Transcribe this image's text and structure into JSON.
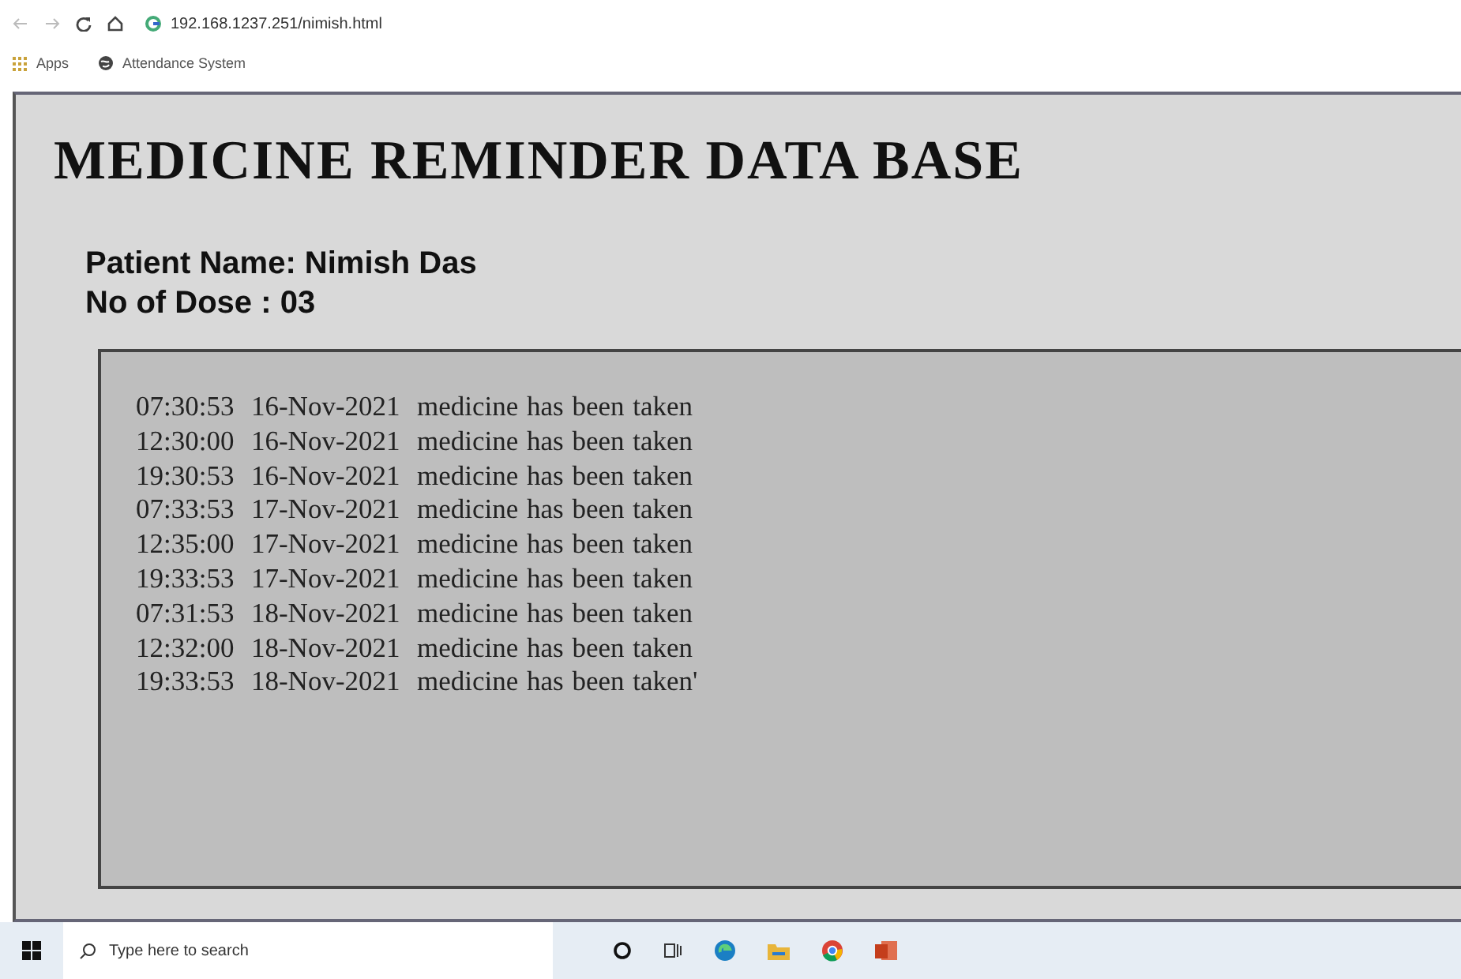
{
  "browser": {
    "address": "192.168.1237.251/nimish.html",
    "bookmarks": [
      "Apps",
      "Attendance System"
    ]
  },
  "page": {
    "title": "MEDICINE REMINDER DATA BASE",
    "patient": "Patient Name: Nimish Das",
    "doses": "No of Dose : 03",
    "log": [
      "07:30:53  16-Nov-2021  medicine has been taken",
      "12:30:00  16-Nov-2021  medicine has been taken",
      "19:30:53  16-Nov-2021  medicine has been taken",
      "07:33:53  17-Nov-2021  medicine has been taken",
      "12:35:00  17-Nov-2021  medicine has been taken",
      "19:33:53  17-Nov-2021  medicine has been taken",
      "07:31:53  18-Nov-2021  medicine has been taken",
      "12:32:00  18-Nov-2021  medicine has been taken",
      "19:33:53  18-Nov-2021  medicine has been taken'"
    ]
  },
  "taskbar": {
    "search_placeholder": "Type here to search"
  }
}
